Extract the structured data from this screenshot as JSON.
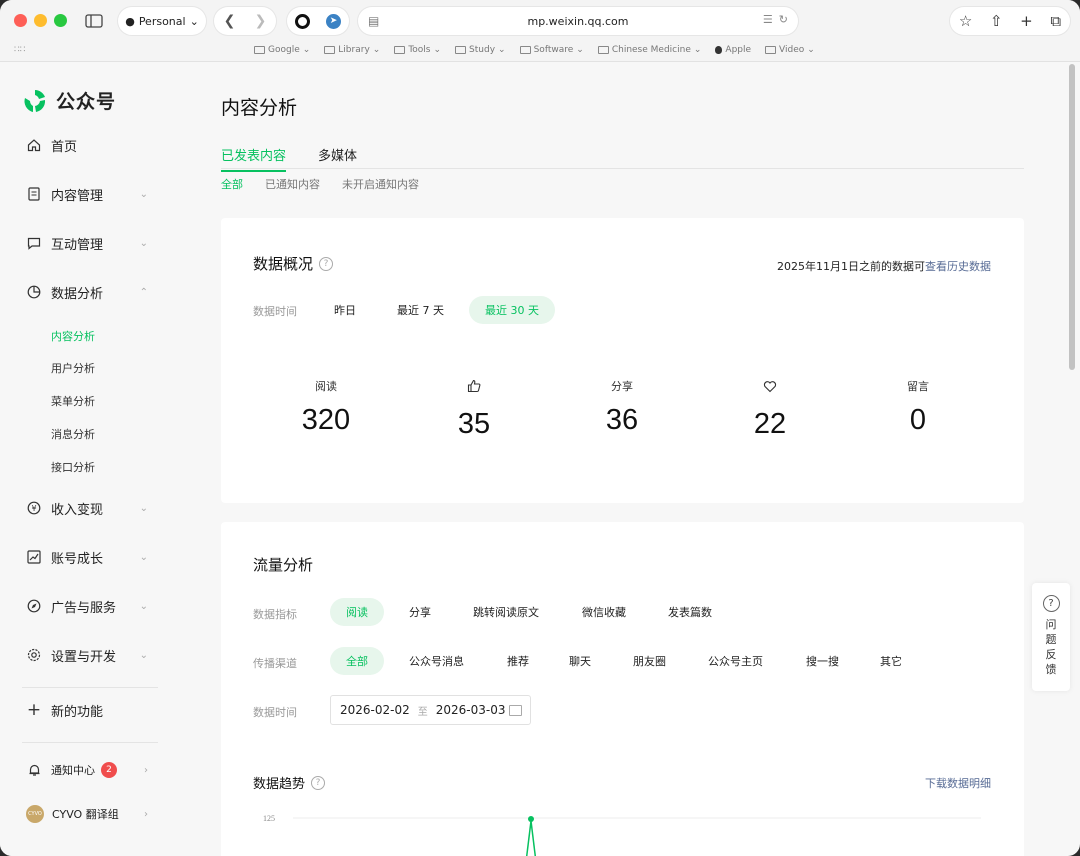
{
  "browser": {
    "profile": "Personal",
    "url": "mp.weixin.qq.com",
    "bookmarks": [
      "Google",
      "Library",
      "Tools",
      "Study",
      "Software",
      "Chinese Medicine",
      "Apple",
      "Video"
    ]
  },
  "brand": {
    "name": "公众号"
  },
  "sidebar": {
    "items": [
      {
        "label": "首页",
        "icon": "home-icon"
      },
      {
        "label": "内容管理",
        "icon": "document-icon"
      },
      {
        "label": "互动管理",
        "icon": "chat-icon"
      },
      {
        "label": "数据分析",
        "icon": "pie-chart-icon"
      },
      {
        "label": "收入变现",
        "icon": "yen-icon"
      },
      {
        "label": "账号成长",
        "icon": "trend-icon"
      },
      {
        "label": "广告与服务",
        "icon": "compass-icon"
      },
      {
        "label": "设置与开发",
        "icon": "gear-icon"
      }
    ],
    "analysis_sub": [
      "内容分析",
      "用户分析",
      "菜单分析",
      "消息分析",
      "接口分析"
    ],
    "new_features": "新的功能",
    "notifications": {
      "label": "通知中心",
      "count": "2"
    },
    "account": {
      "label": "CYVO 翻译组",
      "avatar_text": "CYVO"
    }
  },
  "main": {
    "title": "内容分析",
    "tabs": [
      "已发表内容",
      "多媒体"
    ],
    "subtabs": [
      "全部",
      "已通知内容",
      "未开启通知内容"
    ]
  },
  "overview": {
    "title": "数据概况",
    "history_prefix": "2025年11月1日之前的数据可",
    "history_link": "查看历史数据",
    "time_label": "数据时间",
    "time_options": [
      "昨日",
      "最近 7 天",
      "最近 30 天"
    ],
    "metrics": [
      {
        "label": "阅读",
        "value": "320"
      },
      {
        "label": "",
        "value": "35",
        "icon": "thumbs-up-icon"
      },
      {
        "label": "分享",
        "value": "36"
      },
      {
        "label": "",
        "value": "22",
        "icon": "heart-icon"
      },
      {
        "label": "留言",
        "value": "0"
      }
    ]
  },
  "traffic": {
    "title": "流量分析",
    "metric_label": "数据指标",
    "metric_options": [
      "阅读",
      "分享",
      "跳转阅读原文",
      "微信收藏",
      "发表篇数"
    ],
    "channel_label": "传播渠道",
    "channel_options": [
      "全部",
      "公众号消息",
      "推荐",
      "聊天",
      "朋友圈",
      "公众号主页",
      "搜一搜",
      "其它"
    ],
    "date_label": "数据时间",
    "date_start": "2026-02-02",
    "date_sep": "至",
    "date_end": "2026-03-03",
    "trend_title": "数据趋势",
    "download": "下载数据明细"
  },
  "chart_data": {
    "type": "line",
    "title": "数据趋势",
    "y_tick_visible": "125",
    "x": [],
    "series": [
      {
        "values": []
      }
    ]
  },
  "feedback": {
    "label": "问题反馈"
  },
  "colors": {
    "accent": "#07c160",
    "accent_bg": "#e7f6ec",
    "link": "#576b95",
    "badge": "#f04d4d"
  }
}
